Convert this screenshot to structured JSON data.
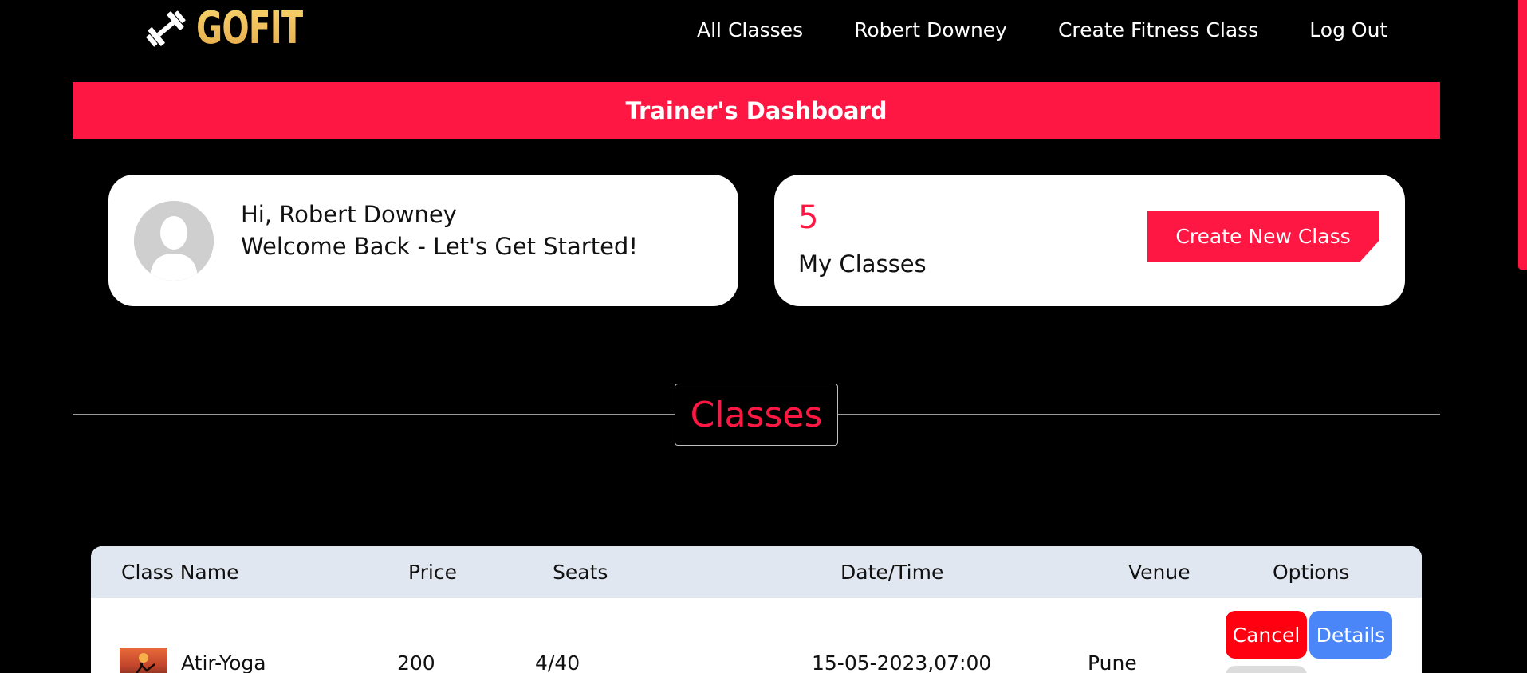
{
  "brand": {
    "name": "GOFIT",
    "icon": "dumbbell-icon",
    "colors": {
      "from": "#f7d36a",
      "to": "#e6a94b"
    }
  },
  "nav": {
    "items": [
      {
        "label": "All Classes"
      },
      {
        "label": "Robert Downey"
      },
      {
        "label": "Create Fitness Class"
      },
      {
        "label": "Log Out"
      }
    ]
  },
  "banner": {
    "title": "Trainer's Dashboard",
    "color": "#ff1744"
  },
  "welcome_card": {
    "greeting": "Hi, Robert Downey",
    "message": "Welcome Back - Let's Get Started!",
    "avatar_icon": "user-silhouette-icon"
  },
  "classes_card": {
    "count": "5",
    "label": "My Classes",
    "create_button": "Create New Class"
  },
  "section": {
    "title": "Classes"
  },
  "table": {
    "columns": [
      "Class Name",
      "Price",
      "Seats",
      "Date/Time",
      "Venue",
      "Options"
    ],
    "rows": [
      {
        "name": "Atir-Yoga",
        "price": "200",
        "seats": "4/40",
        "datetime": "15-05-2023,07:00",
        "venue": "Pune",
        "actions": {
          "cancel": "Cancel",
          "details": "Details"
        }
      }
    ]
  },
  "colors": {
    "accent": "#ff1744",
    "cancel": "#ff0011",
    "details": "#4a86f7",
    "table_header": "#e1e7f1"
  }
}
